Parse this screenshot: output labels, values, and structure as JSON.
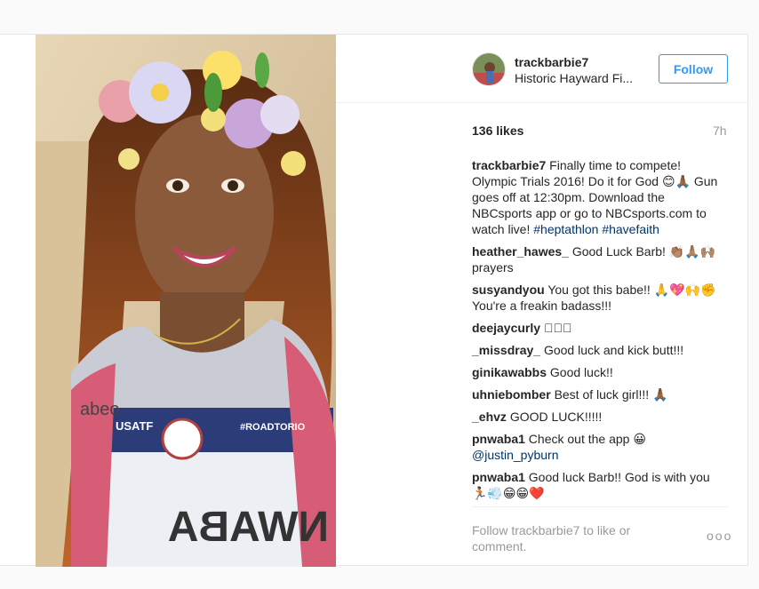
{
  "post": {
    "username": "trackbarbie7",
    "location": "Historic Hayward Fi...",
    "follow_label": "Follow",
    "likes": "136 likes",
    "time": "7h"
  },
  "caption": {
    "user": "trackbarbie7",
    "text": "Finally time to compete! Olympic Trials 2016! Do it for God 😊🙏🏾 Gun goes off at 12:30pm. Download the NBCsports app or go to NBCsports.com to watch live!",
    "tag1": "#heptathlon",
    "tag2": "#havefaith"
  },
  "comments": [
    {
      "user": "heather_hawes_",
      "text": "Good Luck Barb! 👏🏽🙏🏽🙌🏽 prayers"
    },
    {
      "user": "susyandyou",
      "text": "You got this babe!! 🙏💖🙌✊ You're a freakin badass!!!"
    },
    {
      "user": "deejaycurly",
      "text": "🏽🏽🏽"
    },
    {
      "user": "_missdray_",
      "text": "Good luck and kick butt!!!"
    },
    {
      "user": "ginikawabbs",
      "text": "Good luck!!"
    },
    {
      "user": "uhniebomber",
      "text": "Best of luck girl!!! 🙏🏾"
    },
    {
      "user": "_ehvz",
      "text": "GOOD LUCK!!!!!"
    },
    {
      "user": "pnwaba1",
      "text": "Check out the app 😀",
      "mention": "@justin_pyburn"
    },
    {
      "user": "pnwaba1",
      "text": "Good luck Barb!! God is with you 🏃🏾💨😁😁❤️"
    }
  ],
  "footer": {
    "text": "Follow trackbarbie7 to like or comment.",
    "more": "ooo"
  },
  "photo": {
    "jersey_name": "NWABA",
    "usatf": "USATF",
    "oakley": "abeo",
    "roadto": "#ROADTORIO"
  }
}
